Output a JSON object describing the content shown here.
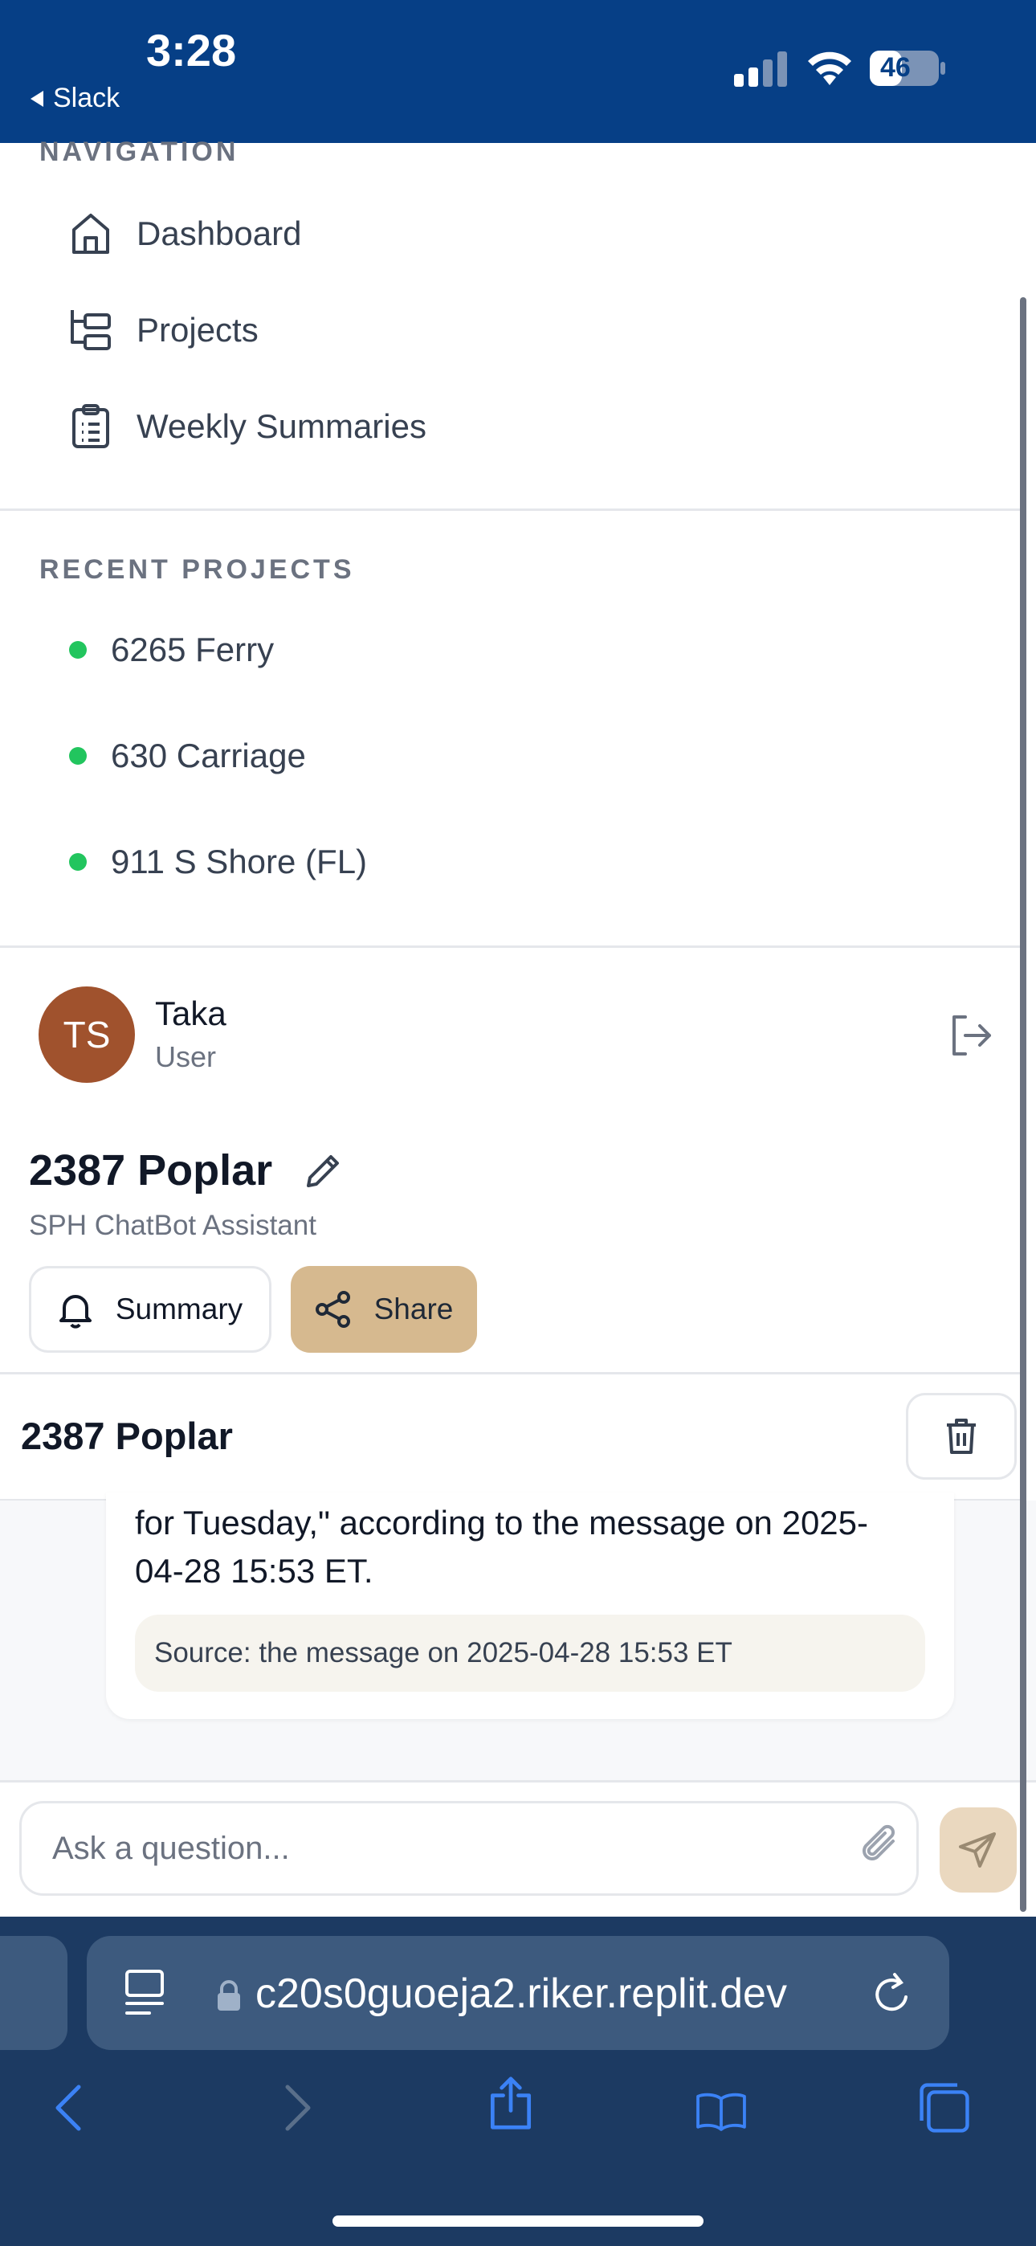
{
  "status_bar": {
    "time": "3:28",
    "back_app": "Slack",
    "battery": "46"
  },
  "navigation": {
    "label": "NAVIGATION",
    "items": [
      {
        "label": "Dashboard",
        "icon": "home-icon"
      },
      {
        "label": "Projects",
        "icon": "folder-tree-icon"
      },
      {
        "label": "Weekly Summaries",
        "icon": "clipboard-list-icon"
      }
    ]
  },
  "recent_projects": {
    "label": "RECENT PROJECTS",
    "items": [
      {
        "label": "6265 Ferry"
      },
      {
        "label": "630 Carriage"
      },
      {
        "label": "911 S Shore (FL)"
      }
    ],
    "dot_color": "#22c55e"
  },
  "user": {
    "initials": "TS",
    "name": "Taka",
    "role": "User",
    "avatar_color": "#a0522d"
  },
  "project": {
    "title": "2387 Poplar",
    "subtitle": "SPH ChatBot Assistant",
    "summary_label": "Summary",
    "share_label": "Share",
    "share_color": "#d6b98f"
  },
  "chat": {
    "header_title": "2387 Poplar",
    "message_line1": "for Tuesday,\" according to the message on 2025-",
    "message_line2": "04-28 15:53 ET.",
    "source": "Source: the message on 2025-04-28 15:53 ET",
    "input_placeholder": "Ask a question..."
  },
  "browser": {
    "url": "c20s0guoeja2.riker.replit.dev"
  },
  "colors": {
    "status_bar": "#063f86",
    "safari_bar": "#1c3a62",
    "url_field": "#3d5a7e"
  }
}
